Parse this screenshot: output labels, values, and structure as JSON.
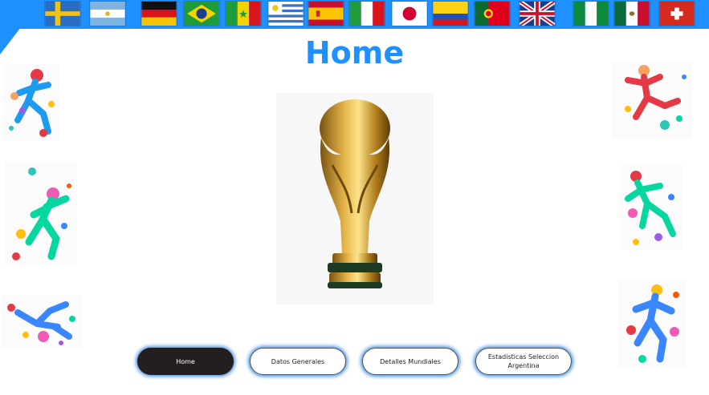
{
  "header": {
    "accent_color": "#1e90ff",
    "flags": [
      {
        "country": "Sweden",
        "icon": "sweden-flag-icon"
      },
      {
        "country": "Argentina",
        "icon": "argentina-flag-icon"
      },
      {
        "country": "Germany",
        "icon": "germany-flag-icon"
      },
      {
        "country": "Brazil",
        "icon": "brazil-flag-icon"
      },
      {
        "country": "Senegal",
        "icon": "senegal-flag-icon"
      },
      {
        "country": "Uruguay",
        "icon": "uruguay-flag-icon"
      },
      {
        "country": "Spain",
        "icon": "spain-flag-icon"
      },
      {
        "country": "Italy",
        "icon": "italy-flag-icon"
      },
      {
        "country": "Japan",
        "icon": "japan-flag-icon"
      },
      {
        "country": "Colombia",
        "icon": "colombia-flag-icon"
      },
      {
        "country": "Portugal",
        "icon": "portugal-flag-icon"
      },
      {
        "country": "United Kingdom",
        "icon": "uk-flag-icon"
      },
      {
        "country": "Nigeria",
        "icon": "nigeria-flag-icon"
      },
      {
        "country": "Mexico",
        "icon": "mexico-flag-icon"
      },
      {
        "country": "Switzerland",
        "icon": "switzerland-flag-icon"
      }
    ]
  },
  "page": {
    "title": "Home"
  },
  "main": {
    "center_image": "world-cup-trophy-image",
    "left_images": [
      "runner-splash-image",
      "kicker-splash-image",
      "bicycle-kick-image"
    ],
    "right_images": [
      "volley-player-image",
      "jump-player-image",
      "dribble-player-image"
    ]
  },
  "nav": {
    "buttons": [
      {
        "label": "Home",
        "active": true
      },
      {
        "label": "Datos Generales",
        "active": false
      },
      {
        "label": "Detalles Mundiales",
        "active": false
      },
      {
        "label": "Estadisticas Seleccion Argentina",
        "active": false
      }
    ],
    "active_color": "#231f20",
    "glow_color": "#4a90e2"
  }
}
